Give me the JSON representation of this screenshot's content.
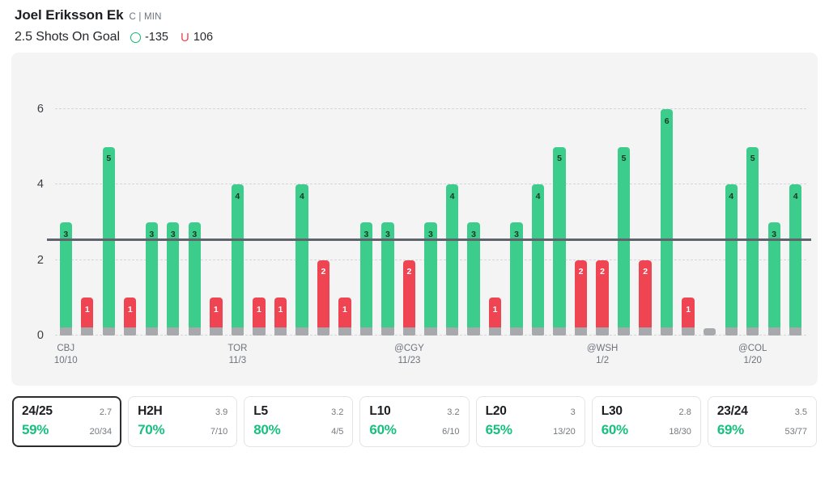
{
  "header": {
    "player_name": "Joel Eriksson Ek",
    "position_team": "C | MIN",
    "prop_label": "2.5 Shots On Goal",
    "over_icon": "circle-o-icon",
    "over_odds": "-135",
    "under_icon": "letter-u-icon",
    "under_odds": "106",
    "over_color": "#12b76a",
    "under_color": "#ef4452"
  },
  "chart_data": {
    "type": "bar",
    "title": "2.5 Shots On Goal",
    "xlabel": "",
    "ylabel": "",
    "ylim": [
      0,
      6.6
    ],
    "yticks": [
      0,
      2,
      4,
      6
    ],
    "grid": true,
    "threshold": 2.5,
    "threshold_color": "#5f636b",
    "over_color": "#3ccd8c",
    "under_color": "#ef4452",
    "zero_color": "#a7a9ad",
    "legend": "none",
    "values": [
      3,
      1,
      5,
      1,
      3,
      3,
      3,
      1,
      4,
      1,
      1,
      4,
      2,
      1,
      3,
      3,
      2,
      3,
      4,
      3,
      1,
      3,
      4,
      5,
      2,
      2,
      5,
      2,
      6,
      1,
      0,
      4,
      5,
      3,
      4
    ],
    "results": [
      "over",
      "under",
      "over",
      "under",
      "over",
      "over",
      "over",
      "under",
      "over",
      "under",
      "under",
      "over",
      "under",
      "under",
      "over",
      "over",
      "under",
      "over",
      "over",
      "over",
      "under",
      "over",
      "over",
      "over",
      "under",
      "under",
      "over",
      "under",
      "over",
      "under",
      "under",
      "over",
      "over",
      "over",
      "over"
    ],
    "axis_labels": [
      {
        "index": 0,
        "team": "CBJ",
        "date": "10/10"
      },
      {
        "index": 8,
        "team": "TOR",
        "date": "11/3"
      },
      {
        "index": 16,
        "team": "@CGY",
        "date": "11/23"
      },
      {
        "index": 25,
        "team": "@WSH",
        "date": "1/2"
      },
      {
        "index": 32,
        "team": "@COL",
        "date": "1/20"
      }
    ]
  },
  "cards": [
    {
      "key": "24/25",
      "avg": "2.7",
      "pct": "59%",
      "record": "20/34",
      "active": true
    },
    {
      "key": "H2H",
      "avg": "3.9",
      "pct": "70%",
      "record": "7/10",
      "active": false
    },
    {
      "key": "L5",
      "avg": "3.2",
      "pct": "80%",
      "record": "4/5",
      "active": false
    },
    {
      "key": "L10",
      "avg": "3.2",
      "pct": "60%",
      "record": "6/10",
      "active": false
    },
    {
      "key": "L20",
      "avg": "3",
      "pct": "65%",
      "record": "13/20",
      "active": false
    },
    {
      "key": "L30",
      "avg": "2.8",
      "pct": "60%",
      "record": "18/30",
      "active": false
    },
    {
      "key": "23/24",
      "avg": "3.5",
      "pct": "69%",
      "record": "53/77",
      "active": false
    }
  ]
}
